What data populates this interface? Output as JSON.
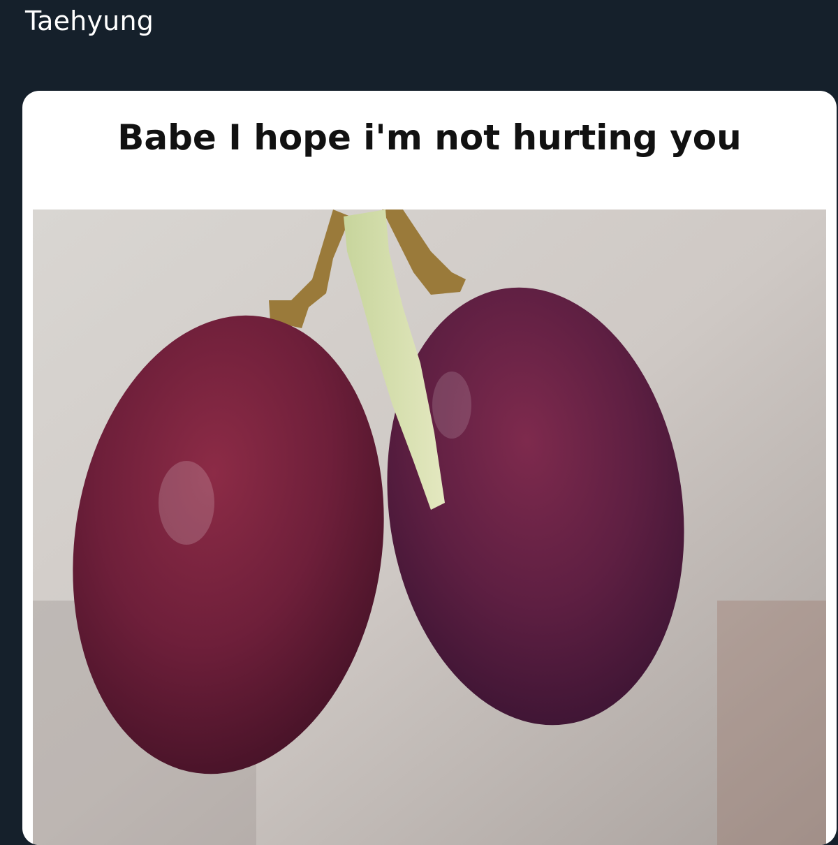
{
  "post": {
    "author_text": "Taehyung"
  },
  "meme": {
    "caption": "Babe I hope i'm not hurting you",
    "image_subject": "two-grapes-photo"
  },
  "colors": {
    "background": "#15202b",
    "card": "#ffffff",
    "grape": "#6b1f3a",
    "stem": "#b8a060"
  }
}
